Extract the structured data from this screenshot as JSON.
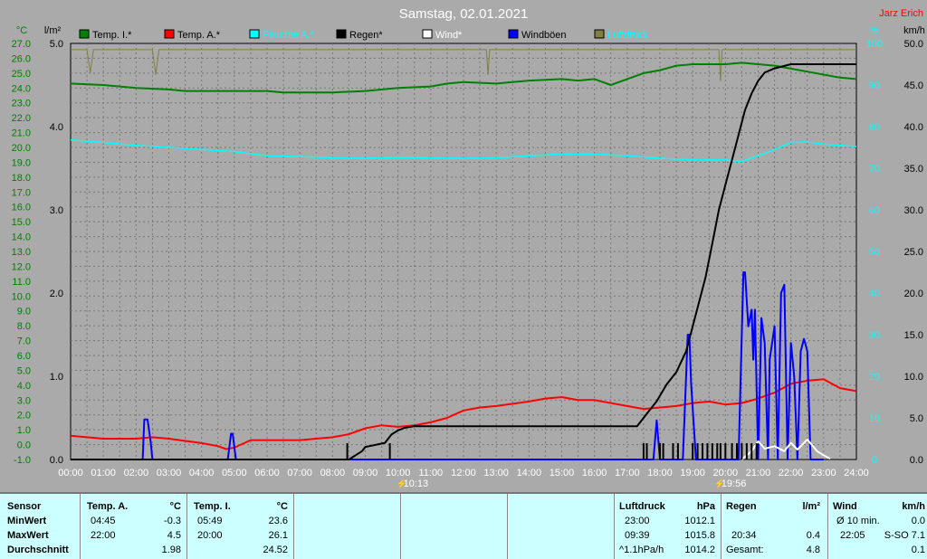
{
  "title": "Samstag, 02.01.2021",
  "author": "Jarz Erich",
  "colors": {
    "background": "#aaaaaa",
    "temp_inside": "#008000",
    "temp_outside": "#ff0000",
    "humidity": "#00ffff",
    "rain": "#000000",
    "wind": "#ffffff",
    "gusts": "#0000ff",
    "pressure": "#808040",
    "stats_bg": "#ccffff"
  },
  "axes": {
    "left_unit": "°C",
    "rain_unit": "l/m²",
    "humidity_unit": "%",
    "wind_unit": "km/h"
  },
  "chart_data": {
    "type": "line",
    "x_ticks": [
      "00:00",
      "01:00",
      "02:00",
      "03:00",
      "04:00",
      "05:00",
      "06:00",
      "07:00",
      "08:00",
      "09:00",
      "10:00",
      "11:00",
      "12:00",
      "13:00",
      "14:00",
      "15:00",
      "16:00",
      "17:00",
      "18:00",
      "19:00",
      "20:00",
      "21:00",
      "22:00",
      "23:00",
      "24:00"
    ],
    "temp_ticks": [
      "27.0",
      "26.0",
      "25.0",
      "24.0",
      "23.0",
      "22.0",
      "21.0",
      "20.0",
      "19.0",
      "18.0",
      "17.0",
      "16.0",
      "15.0",
      "14.0",
      "13.0",
      "12.0",
      "11.0",
      "10.0",
      "9.0",
      "8.0",
      "7.0",
      "6.0",
      "5.0",
      "4.0",
      "3.0",
      "2.0",
      "1.0",
      "0.0",
      "-1.0"
    ],
    "temp_range": [
      -1,
      27
    ],
    "rain_ticks": [
      "5.0",
      "4.0",
      "3.0",
      "2.0",
      "1.0",
      "0.0"
    ],
    "rain_range": [
      0,
      5
    ],
    "humidity_ticks": [
      "100",
      "90",
      "80",
      "70",
      "60",
      "50",
      "40",
      "30",
      "20",
      "10",
      "0"
    ],
    "humidity_range": [
      0,
      100
    ],
    "wind_ticks": [
      "50.0",
      "45.0",
      "40.0",
      "35.0",
      "30.0",
      "25.0",
      "20.0",
      "15.0",
      "10.0",
      "5.0",
      "0.0"
    ],
    "wind_range": [
      0,
      50
    ],
    "x_range": [
      0,
      24
    ],
    "legend": [
      {
        "name": "Temp. I.*",
        "color": "#008000"
      },
      {
        "name": "Temp. A.*",
        "color": "#ff0000"
      },
      {
        "name": "Feuchte A.*",
        "color": "#00ffff"
      },
      {
        "name": "Regen*",
        "color": "#000000"
      },
      {
        "name": "Wind*",
        "color": "#ffffff"
      },
      {
        "name": "Windböen",
        "color": "#0000ff"
      },
      {
        "name": "Luftdruck",
        "color": "#808040"
      }
    ],
    "annotations": [
      "10:13",
      "19:56"
    ],
    "series": [
      {
        "name": "Temp. I.*",
        "axis": "temp",
        "x": [
          0,
          1,
          2,
          3,
          3.5,
          4,
          5,
          6,
          6.5,
          7,
          8,
          9,
          10,
          11,
          11.5,
          12,
          13,
          14,
          15,
          15.5,
          16,
          16.5,
          17,
          17.5,
          18,
          18.5,
          19,
          19.5,
          20,
          20.5,
          21,
          21.5,
          22,
          22.5,
          23,
          23.5,
          24
        ],
        "y": [
          24.3,
          24.2,
          24.0,
          23.9,
          23.8,
          23.8,
          23.8,
          23.8,
          23.7,
          23.7,
          23.7,
          23.8,
          24.0,
          24.1,
          24.3,
          24.4,
          24.3,
          24.5,
          24.6,
          24.5,
          24.6,
          24.2,
          24.6,
          25.0,
          25.2,
          25.5,
          25.6,
          25.6,
          25.6,
          25.7,
          25.6,
          25.5,
          25.3,
          25.1,
          24.9,
          24.7,
          24.6
        ]
      },
      {
        "name": "Temp. A.*",
        "axis": "temp",
        "x": [
          0,
          0.5,
          1,
          2,
          2.5,
          3,
          4,
          4.5,
          4.75,
          5,
          5.5,
          6,
          7,
          8,
          8.5,
          9,
          9.5,
          10,
          10.5,
          11,
          11.5,
          12,
          12.5,
          13,
          14,
          14.5,
          15,
          15.5,
          16,
          17,
          17.5,
          18,
          18.5,
          19,
          19.5,
          20,
          20.5,
          21,
          21.5,
          22,
          22.5,
          23,
          23.5,
          24
        ],
        "y": [
          0.6,
          0.5,
          0.4,
          0.4,
          0.5,
          0.4,
          0.1,
          -0.1,
          -0.3,
          -0.2,
          0.3,
          0.3,
          0.3,
          0.5,
          0.7,
          1.1,
          1.3,
          1.2,
          1.3,
          1.5,
          1.8,
          2.3,
          2.5,
          2.6,
          2.9,
          3.1,
          3.2,
          3.0,
          3.0,
          2.6,
          2.4,
          2.5,
          2.6,
          2.8,
          2.9,
          2.7,
          2.8,
          3.1,
          3.5,
          4.1,
          4.3,
          4.4,
          3.8,
          3.6
        ]
      },
      {
        "name": "Feuchte A.*",
        "axis": "humidity",
        "x": [
          0,
          1,
          2,
          3,
          4,
          5,
          5.5,
          6,
          7,
          8,
          9,
          10,
          11,
          12,
          13,
          14,
          15,
          16,
          17,
          18,
          19,
          20,
          20.5,
          21,
          21.5,
          22,
          22.5,
          23,
          24
        ],
        "y": [
          76.8,
          76.2,
          75.5,
          75.0,
          74.5,
          74.0,
          73.5,
          73.0,
          72.8,
          72.5,
          72.4,
          72.6,
          72.5,
          72.4,
          72.5,
          73.0,
          73.4,
          73.4,
          73.0,
          72.4,
          72.0,
          72.0,
          71.6,
          73.0,
          74.5,
          76.2,
          76.3,
          75.8,
          75.2
        ]
      },
      {
        "name": "Regen*",
        "axis": "rain",
        "x": [
          0,
          8.4,
          8.5,
          8.9,
          9.0,
          9.6,
          9.7,
          9.8,
          10.0,
          10.2,
          10.5,
          17.3,
          17.6,
          17.9,
          18.2,
          18.5,
          18.8,
          19.0,
          19.2,
          19.4,
          19.6,
          19.8,
          20.0,
          20.2,
          20.4,
          20.6,
          20.8,
          21.0,
          21.2,
          21.5,
          22.0,
          23.0,
          24.0
        ],
        "y": [
          0,
          0,
          0,
          0.1,
          0.15,
          0.2,
          0.25,
          0.3,
          0.35,
          0.38,
          0.4,
          0.4,
          0.55,
          0.7,
          0.9,
          1.05,
          1.3,
          1.6,
          1.9,
          2.2,
          2.6,
          3.0,
          3.3,
          3.6,
          3.9,
          4.2,
          4.4,
          4.55,
          4.65,
          4.7,
          4.75,
          4.75,
          4.75
        ]
      },
      {
        "name": "Wind*",
        "axis": "wind",
        "x": [
          20.5,
          20.8,
          21.0,
          21.2,
          21.5,
          21.8,
          22.0,
          22.2,
          22.5,
          22.8,
          23.0,
          23.2
        ],
        "y": [
          0,
          1.0,
          2.2,
          1.3,
          1.6,
          1.0,
          2.0,
          1.2,
          2.4,
          1.0,
          0.5,
          0.1
        ]
      },
      {
        "name": "Windböen",
        "axis": "wind",
        "x": [
          2.2,
          2.25,
          2.35,
          2.45,
          2.5,
          4.8,
          4.9,
          4.95,
          5.05,
          5.1,
          17.8,
          17.9,
          18.0,
          18.7,
          18.85,
          18.9,
          18.95,
          19.1,
          20.4,
          20.55,
          20.6,
          20.7,
          20.8,
          20.85,
          20.9,
          21.0,
          21.1,
          21.2,
          21.3,
          21.35,
          21.5,
          21.6,
          21.7,
          21.8,
          21.9,
          22.0,
          22.1,
          22.2,
          22.3,
          22.4,
          22.5,
          22.6,
          22.7,
          22.8,
          22.9,
          23.0
        ],
        "y": [
          0,
          4.8,
          4.8,
          2.0,
          0,
          0,
          3.1,
          3.1,
          0,
          0,
          0,
          4.7,
          0,
          0,
          15.0,
          15.0,
          9.2,
          0,
          0,
          22.5,
          22.5,
          16.0,
          18.0,
          12.0,
          18.0,
          0,
          17.0,
          14.0,
          0,
          12.0,
          16.0,
          0,
          20.0,
          21.0,
          0,
          14.0,
          10.0,
          0,
          13.0,
          14.5,
          13.0,
          0,
          0,
          0,
          0,
          0
        ]
      },
      {
        "name": "Luftdruck",
        "axis": "humidity",
        "x": [
          0,
          0.5,
          0.6,
          0.7,
          1,
          2,
          2.5,
          2.6,
          2.7,
          3,
          4,
          5,
          6,
          7,
          8,
          9,
          10,
          11,
          12,
          12.7,
          12.75,
          12.8,
          13,
          14,
          15,
          16,
          17,
          18,
          19,
          19.8,
          19.85,
          19.9,
          20,
          21,
          22,
          23,
          24
        ],
        "y": [
          98.5,
          98.5,
          93.0,
          98.5,
          98.5,
          98.5,
          98.5,
          92.5,
          98.5,
          98.5,
          98.5,
          98.5,
          98.5,
          98.5,
          98.5,
          98.5,
          98.5,
          98.5,
          98.5,
          98.5,
          92.5,
          98.5,
          98.5,
          98.5,
          98.5,
          98.5,
          98.5,
          98.5,
          98.5,
          98.5,
          91.0,
          98.5,
          98.5,
          98.5,
          98.5,
          98.5,
          98.5
        ]
      }
    ]
  },
  "stats": {
    "headers": {
      "sensor": "Sensor",
      "temp_a": "Temp. A.",
      "temp_a_unit": "°C",
      "temp_i": "Temp. I.",
      "temp_i_unit": "°C",
      "pressure": "Luftdruck",
      "pressure_unit": "hPa",
      "rain": "Regen",
      "rain_unit": "l/m²",
      "wind": "Wind",
      "wind_unit": "km/h"
    },
    "rows": {
      "min_label": "MinWert",
      "max_label": "MaxWert",
      "avg_label": "Durchschnitt"
    },
    "temp_a": {
      "min_time": "04:45",
      "min": "-0.3",
      "max_time": "22:00",
      "max": "4.5",
      "avg": "1.98"
    },
    "temp_i": {
      "min_time": "05:49",
      "min": "23.6",
      "max_time": "20:00",
      "max": "26.1",
      "avg": "24.52"
    },
    "pressure": {
      "min_time": "23:00",
      "min": "1012.1",
      "max_time": "09:39",
      "max": "1015.8",
      "trend_label": "^1.1hPa/h",
      "trend_value": "1014.2"
    },
    "rain": {
      "max_time": "20:34",
      "max": "0.4",
      "total_label": "Gesamt:",
      "total": "4.8"
    },
    "wind": {
      "min_label": "Ø 10 min.",
      "min": "0.0",
      "max_time": "22:05",
      "max": "S-SO 7.1",
      "avg": "0.1"
    }
  }
}
